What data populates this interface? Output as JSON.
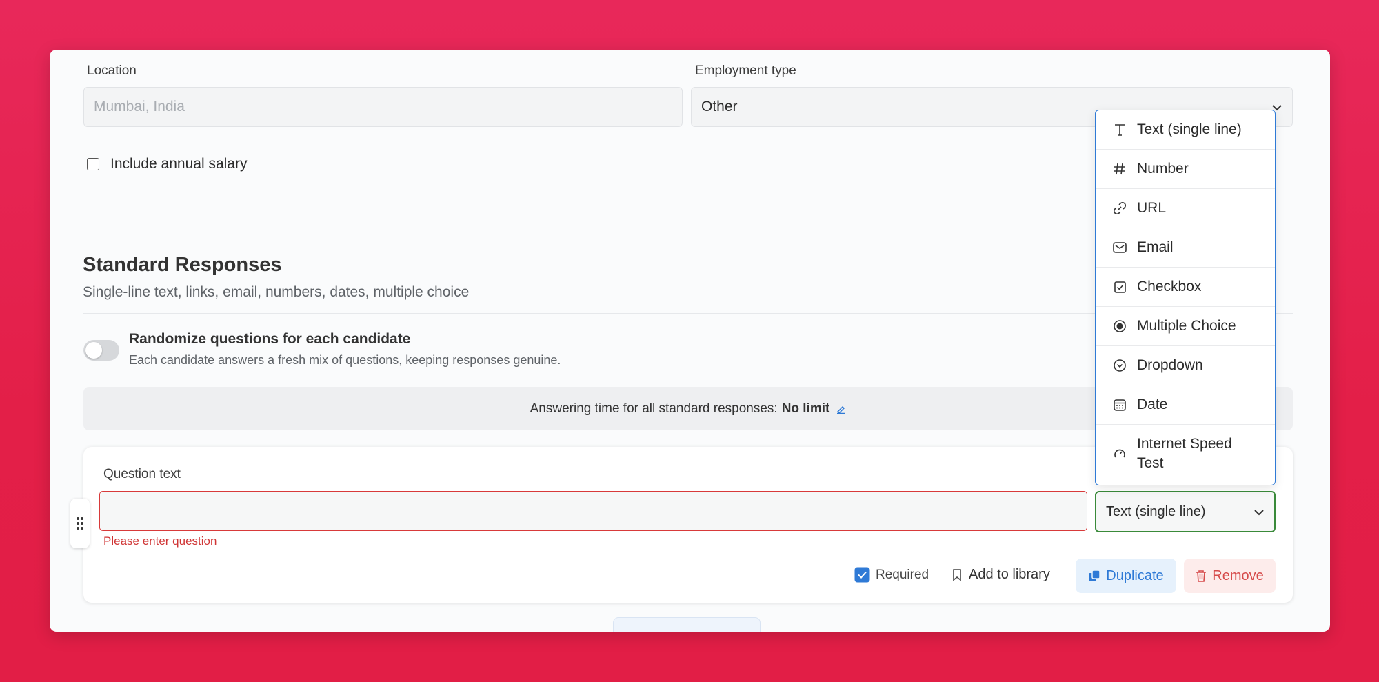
{
  "form": {
    "location_label": "Location",
    "location_placeholder": "Mumbai, India",
    "employment_label": "Employment type",
    "employment_value": "Other",
    "salary_label": "Include annual salary"
  },
  "standard": {
    "title": "Standard Responses",
    "subtitle": "Single-line text, links, email, numbers, dates, multiple choice",
    "randomize_title": "Randomize questions for each candidate",
    "randomize_desc": "Each candidate answers a fresh mix of questions, keeping responses genuine.",
    "time_prefix": "Answering time for all standard responses:",
    "time_value": "No limit"
  },
  "question": {
    "label": "Question text",
    "error": "Please enter question",
    "type_value": "Text (single line)",
    "required_label": "Required",
    "library_label": "Add to library",
    "duplicate_label": "Duplicate",
    "remove_label": "Remove"
  },
  "dropdown": {
    "items": [
      {
        "label": "Text (single line)",
        "icon": "text-icon"
      },
      {
        "label": "Number",
        "icon": "hash-icon"
      },
      {
        "label": "URL",
        "icon": "link-icon"
      },
      {
        "label": "Email",
        "icon": "mail-icon"
      },
      {
        "label": "Checkbox",
        "icon": "checkbox-icon"
      },
      {
        "label": "Multiple Choice",
        "icon": "radio-icon"
      },
      {
        "label": "Dropdown",
        "icon": "chevron-circle-icon"
      },
      {
        "label": "Date",
        "icon": "calendar-icon"
      },
      {
        "label": "Internet Speed Test",
        "icon": "speedometer-icon"
      }
    ]
  },
  "colors": {
    "background": "#e5214e",
    "accent_blue": "#2f7ad6",
    "error_red": "#d03636",
    "success_green": "#3a8a3a"
  }
}
